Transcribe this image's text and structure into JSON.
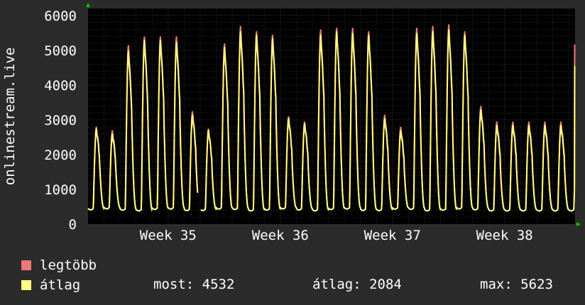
{
  "chart_data": {
    "type": "line",
    "ylabel": "onlinestream.live",
    "xlabel": "",
    "ylim": [
      0,
      6200
    ],
    "y_ticks": [
      0,
      1000,
      2000,
      3000,
      4000,
      5000,
      6000
    ],
    "x_range_days": [
      0,
      30.4
    ],
    "x_ticks": [
      {
        "label": "Week 35",
        "day": 5
      },
      {
        "label": "Week 36",
        "day": 12
      },
      {
        "label": "Week 37",
        "day": 19
      },
      {
        "label": "Week 38",
        "day": 26
      }
    ],
    "grid": true,
    "series": [
      {
        "name": "legtöbb",
        "color": "#f07878",
        "daily_peaks": [
          2800,
          2700,
          5150,
          5400,
          5400,
          5400,
          3250,
          2750,
          5200,
          5700,
          5550,
          5450,
          3100,
          2950,
          5600,
          5650,
          5650,
          5550,
          3150,
          2800,
          5650,
          5700,
          5750,
          5550,
          3400,
          2950
        ]
      },
      {
        "name": "átlag",
        "color": "#ffff80",
        "daily_peaks": [
          2750,
          2600,
          5000,
          5300,
          5300,
          5250,
          3150,
          2700,
          5100,
          5550,
          5450,
          5350,
          3050,
          2900,
          5450,
          5550,
          5500,
          5450,
          3050,
          2700,
          5500,
          5550,
          5600,
          5450,
          3300,
          2850
        ]
      }
    ],
    "gap_day": 6.85,
    "end_values": {
      "legtöbb": 5150,
      "átlag": 4532
    }
  },
  "legend": {
    "max_label": "legtöbb",
    "avg_label": "átlag",
    "max_color": "#f07878",
    "avg_color": "#ffff80"
  },
  "stats": {
    "now": "most: 4532",
    "avg": "átlag: 2084",
    "max": "max: 5623"
  },
  "colors": {
    "background": "#2b2b2b",
    "plot_background": "#000000",
    "grid_major": "#5a2a2a",
    "grid_minor": "#2e2e2e",
    "arrow": "#00cc00",
    "axis_text": "#ffffff"
  }
}
